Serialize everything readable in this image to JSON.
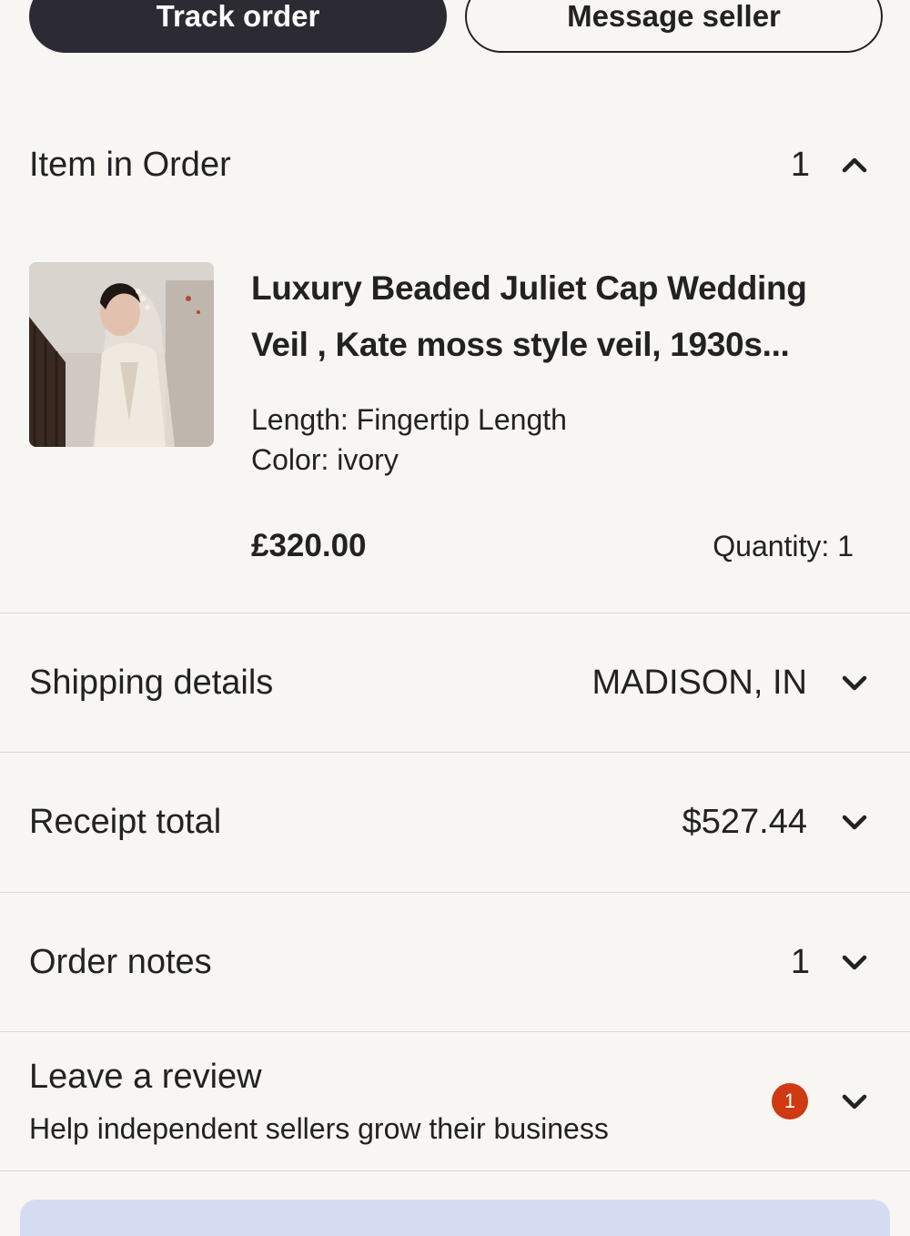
{
  "actions": {
    "track_label": "Track order",
    "message_label": "Message seller"
  },
  "items_section": {
    "title": "Item in Order",
    "count": "1",
    "expanded_icon": "chevron-up-icon"
  },
  "item": {
    "title_line1": "Luxury Beaded Juliet Cap Wedding",
    "title_line2": "Veil  , Kate moss style veil, 1930s...",
    "length": "Length: Fingertip Length",
    "color": "Color: ivory",
    "price": "£320.00",
    "quantity": "Quantity: 1"
  },
  "shipping": {
    "title": "Shipping details",
    "value": "MADISON, IN"
  },
  "receipt": {
    "title": "Receipt total",
    "value": "$527.44"
  },
  "notes": {
    "title": "Order notes",
    "value": "1"
  },
  "review": {
    "title": "Leave a review",
    "subtitle": "Help independent sellers grow their business",
    "badge": "1"
  },
  "colors": {
    "background": "#f7f6f3",
    "primary_button": "#2c2a33",
    "badge": "#cf3a12",
    "bottom_card": "#d5dcf2"
  }
}
